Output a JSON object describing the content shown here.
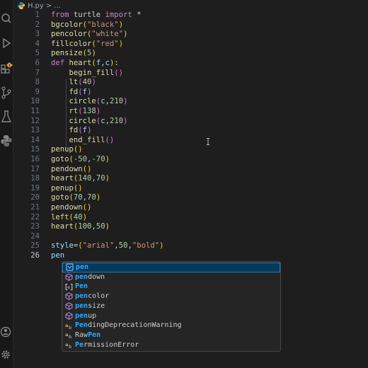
{
  "breadcrumb": {
    "file": "H.py",
    "sep": ">",
    "ellipsis": "..."
  },
  "colors": {
    "background": "#1e1e1e",
    "keyword": "#c586c0",
    "function": "#dcdcaa",
    "string": "#ce9178",
    "number": "#b5cea8",
    "highlight": "#2aaaff"
  },
  "activity_icons": [
    "search-icon",
    "run-debug-icon",
    "extensions-icon",
    "source-control-icon",
    "testing-icon",
    "python-icon",
    "account-icon",
    "settings-gear-icon"
  ],
  "code_lines": [
    {
      "n": "1",
      "tokens": [
        [
          "k",
          "from"
        ],
        [
          "p",
          " turtle "
        ],
        [
          "k",
          "import"
        ],
        [
          "p",
          " *"
        ]
      ]
    },
    {
      "n": "2",
      "tokens": [
        [
          "f",
          "bgcolor"
        ],
        [
          "b1",
          "("
        ],
        [
          "s",
          "\"black\""
        ],
        [
          "b1",
          ")"
        ]
      ]
    },
    {
      "n": "3",
      "tokens": [
        [
          "f",
          "pencolor"
        ],
        [
          "b1",
          "("
        ],
        [
          "s",
          "\"white\""
        ],
        [
          "b1",
          ")"
        ]
      ]
    },
    {
      "n": "4",
      "tokens": [
        [
          "f",
          "fillcolor"
        ],
        [
          "b1",
          "("
        ],
        [
          "s",
          "\"red\""
        ],
        [
          "b1",
          ")"
        ]
      ]
    },
    {
      "n": "5",
      "tokens": [
        [
          "f",
          "pensize"
        ],
        [
          "b1",
          "("
        ],
        [
          "n",
          "5"
        ],
        [
          "b1",
          ")"
        ]
      ]
    },
    {
      "n": "6",
      "tokens": [
        [
          "k",
          "def"
        ],
        [
          "p",
          " "
        ],
        [
          "f",
          "heart"
        ],
        [
          "b1",
          "("
        ],
        [
          "v",
          "f"
        ],
        [
          "p",
          ","
        ],
        [
          "v",
          "c"
        ],
        [
          "b1",
          ")"
        ],
        [
          "p",
          ":"
        ]
      ]
    },
    {
      "n": "7",
      "tokens": [
        [
          "p",
          "    "
        ],
        [
          "f",
          "begin_fill"
        ],
        [
          "b2",
          "()"
        ]
      ]
    },
    {
      "n": "8",
      "tokens": [
        [
          "p",
          "    "
        ],
        [
          "f",
          "lt"
        ],
        [
          "b2",
          "("
        ],
        [
          "n",
          "40"
        ],
        [
          "b2",
          ")"
        ]
      ]
    },
    {
      "n": "9",
      "tokens": [
        [
          "p",
          "    "
        ],
        [
          "f",
          "fd"
        ],
        [
          "b2",
          "("
        ],
        [
          "v",
          "f"
        ],
        [
          "b2",
          ")"
        ]
      ]
    },
    {
      "n": "10",
      "tokens": [
        [
          "p",
          "    "
        ],
        [
          "f",
          "circle"
        ],
        [
          "b2",
          "("
        ],
        [
          "v",
          "c"
        ],
        [
          "p",
          ","
        ],
        [
          "n",
          "210"
        ],
        [
          "b2",
          ")"
        ]
      ]
    },
    {
      "n": "11",
      "tokens": [
        [
          "p",
          "    "
        ],
        [
          "f",
          "rt"
        ],
        [
          "b2",
          "("
        ],
        [
          "n",
          "138"
        ],
        [
          "b2",
          ")"
        ]
      ]
    },
    {
      "n": "12",
      "tokens": [
        [
          "p",
          "    "
        ],
        [
          "f",
          "circle"
        ],
        [
          "b2",
          "("
        ],
        [
          "v",
          "c"
        ],
        [
          "p",
          ","
        ],
        [
          "n",
          "210"
        ],
        [
          "b2",
          ")"
        ]
      ]
    },
    {
      "n": "13",
      "tokens": [
        [
          "p",
          "    "
        ],
        [
          "f",
          "fd"
        ],
        [
          "b2",
          "("
        ],
        [
          "v",
          "f"
        ],
        [
          "b2",
          ")"
        ]
      ]
    },
    {
      "n": "14",
      "tokens": [
        [
          "p",
          "    "
        ],
        [
          "f",
          "end_fill"
        ],
        [
          "b2",
          "()"
        ]
      ]
    },
    {
      "n": "15",
      "tokens": [
        [
          "f",
          "penup"
        ],
        [
          "b1",
          "()"
        ]
      ]
    },
    {
      "n": "16",
      "tokens": [
        [
          "f",
          "goto"
        ],
        [
          "b1",
          "("
        ],
        [
          "n",
          "-50"
        ],
        [
          "p",
          ","
        ],
        [
          "n",
          "-70"
        ],
        [
          "b1",
          ")"
        ]
      ]
    },
    {
      "n": "17",
      "tokens": [
        [
          "f",
          "pendown"
        ],
        [
          "b1",
          "()"
        ]
      ]
    },
    {
      "n": "18",
      "tokens": [
        [
          "f",
          "heart"
        ],
        [
          "b1",
          "("
        ],
        [
          "n",
          "140"
        ],
        [
          "p",
          ","
        ],
        [
          "n",
          "70"
        ],
        [
          "b1",
          ")"
        ]
      ]
    },
    {
      "n": "19",
      "tokens": [
        [
          "f",
          "penup"
        ],
        [
          "b1",
          "()"
        ]
      ]
    },
    {
      "n": "20",
      "tokens": [
        [
          "f",
          "goto"
        ],
        [
          "b1",
          "("
        ],
        [
          "n",
          "70"
        ],
        [
          "p",
          ","
        ],
        [
          "n",
          "70"
        ],
        [
          "b1",
          ")"
        ]
      ]
    },
    {
      "n": "21",
      "tokens": [
        [
          "f",
          "pendown"
        ],
        [
          "b1",
          "()"
        ]
      ]
    },
    {
      "n": "22",
      "tokens": [
        [
          "f",
          "left"
        ],
        [
          "b1",
          "("
        ],
        [
          "n",
          "40"
        ],
        [
          "b1",
          ")"
        ]
      ]
    },
    {
      "n": "23",
      "tokens": [
        [
          "f",
          "heart"
        ],
        [
          "b1",
          "("
        ],
        [
          "n",
          "100"
        ],
        [
          "p",
          ","
        ],
        [
          "n",
          "50"
        ],
        [
          "b1",
          ")"
        ]
      ]
    },
    {
      "n": "24",
      "tokens": []
    },
    {
      "n": "25",
      "tokens": [
        [
          "v",
          "style"
        ],
        [
          "p",
          "="
        ],
        [
          "b1",
          "("
        ],
        [
          "s",
          "\"arial\""
        ],
        [
          "p",
          ","
        ],
        [
          "n",
          "50"
        ],
        [
          "p",
          ","
        ],
        [
          "s",
          "\"bold\""
        ],
        [
          "b1",
          ")"
        ]
      ]
    },
    {
      "n": "26",
      "tokens": [
        [
          "v",
          "pen"
        ]
      ]
    }
  ],
  "suggestions": [
    {
      "match": "pen",
      "rest": "",
      "kind": "variable",
      "selected": true
    },
    {
      "match": "pen",
      "rest": "down",
      "kind": "function"
    },
    {
      "match": "Pen",
      "rest": "",
      "kind": "class"
    },
    {
      "match": "pen",
      "rest": "color",
      "kind": "function"
    },
    {
      "match": "pen",
      "rest": "size",
      "kind": "function"
    },
    {
      "match": "pen",
      "rest": "up",
      "kind": "function"
    },
    {
      "match": "Pen",
      "rest": "dingDeprecationWarning",
      "kind": "reference"
    },
    {
      "match": "",
      "rest": "RawPen",
      "kind": "reference",
      "partial": [
        "Raw",
        "Pen"
      ]
    },
    {
      "match": "Pe",
      "rest": "rmissionError",
      "kind": "reference"
    }
  ]
}
